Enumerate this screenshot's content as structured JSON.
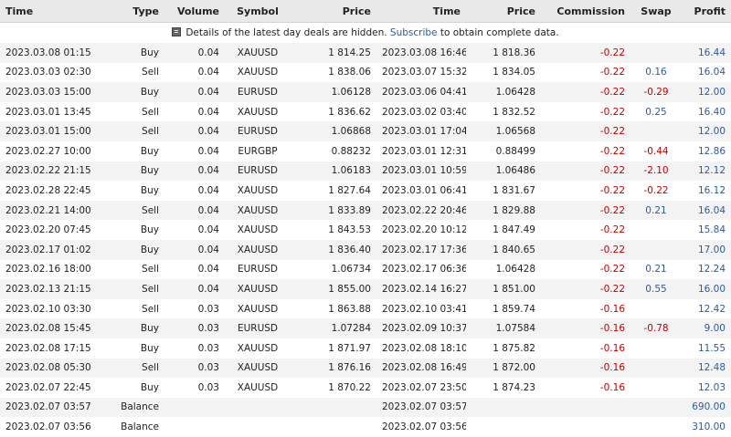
{
  "headers": [
    "Time",
    "Type",
    "Volume",
    "Symbol",
    "Price",
    "Time",
    "Price",
    "Commission",
    "Swap",
    "Profit"
  ],
  "notice": {
    "text_before": "Details of the latest day deals are hidden.",
    "link": "Subscribe",
    "text_after": "to obtain complete data."
  },
  "rows": [
    {
      "open_time": "2023.03.08 01:15",
      "type": "Buy",
      "volume": "0.04",
      "symbol": "XAUUSD",
      "open_price": "1 814.25",
      "close_time": "2023.03.08 16:46",
      "close_price": "1 818.36",
      "commission": "-0.22",
      "swap": "",
      "profit": "16.44"
    },
    {
      "open_time": "2023.03.03 02:30",
      "type": "Sell",
      "volume": "0.04",
      "symbol": "XAUUSD",
      "open_price": "1 838.06",
      "close_time": "2023.03.07 15:32",
      "close_price": "1 834.05",
      "commission": "-0.22",
      "swap": "0.16",
      "profit": "16.04"
    },
    {
      "open_time": "2023.03.03 15:00",
      "type": "Buy",
      "volume": "0.04",
      "symbol": "EURUSD",
      "open_price": "1.06128",
      "close_time": "2023.03.06 04:41",
      "close_price": "1.06428",
      "commission": "-0.22",
      "swap": "-0.29",
      "profit": "12.00"
    },
    {
      "open_time": "2023.03.01 13:45",
      "type": "Sell",
      "volume": "0.04",
      "symbol": "XAUUSD",
      "open_price": "1 836.62",
      "close_time": "2023.03.02 03:40",
      "close_price": "1 832.52",
      "commission": "-0.22",
      "swap": "0.25",
      "profit": "16.40"
    },
    {
      "open_time": "2023.03.01 15:00",
      "type": "Sell",
      "volume": "0.04",
      "symbol": "EURUSD",
      "open_price": "1.06868",
      "close_time": "2023.03.01 17:04",
      "close_price": "1.06568",
      "commission": "-0.22",
      "swap": "",
      "profit": "12.00"
    },
    {
      "open_time": "2023.02.27 10:00",
      "type": "Buy",
      "volume": "0.04",
      "symbol": "EURGBP",
      "open_price": "0.88232",
      "close_time": "2023.03.01 12:31",
      "close_price": "0.88499",
      "commission": "-0.22",
      "swap": "-0.44",
      "profit": "12.86"
    },
    {
      "open_time": "2023.02.22 21:15",
      "type": "Buy",
      "volume": "0.04",
      "symbol": "EURUSD",
      "open_price": "1.06183",
      "close_time": "2023.03.01 10:59",
      "close_price": "1.06486",
      "commission": "-0.22",
      "swap": "-2.10",
      "profit": "12.12"
    },
    {
      "open_time": "2023.02.28 22:45",
      "type": "Buy",
      "volume": "0.04",
      "symbol": "XAUUSD",
      "open_price": "1 827.64",
      "close_time": "2023.03.01 06:41",
      "close_price": "1 831.67",
      "commission": "-0.22",
      "swap": "-0.22",
      "profit": "16.12"
    },
    {
      "open_time": "2023.02.21 14:00",
      "type": "Sell",
      "volume": "0.04",
      "symbol": "XAUUSD",
      "open_price": "1 833.89",
      "close_time": "2023.02.22 20:46",
      "close_price": "1 829.88",
      "commission": "-0.22",
      "swap": "0.21",
      "profit": "16.04"
    },
    {
      "open_time": "2023.02.20 07:45",
      "type": "Buy",
      "volume": "0.04",
      "symbol": "XAUUSD",
      "open_price": "1 843.53",
      "close_time": "2023.02.20 10:12",
      "close_price": "1 847.49",
      "commission": "-0.22",
      "swap": "",
      "profit": "15.84"
    },
    {
      "open_time": "2023.02.17 01:02",
      "type": "Buy",
      "volume": "0.04",
      "symbol": "XAUUSD",
      "open_price": "1 836.40",
      "close_time": "2023.02.17 17:36",
      "close_price": "1 840.65",
      "commission": "-0.22",
      "swap": "",
      "profit": "17.00"
    },
    {
      "open_time": "2023.02.16 18:00",
      "type": "Sell",
      "volume": "0.04",
      "symbol": "EURUSD",
      "open_price": "1.06734",
      "close_time": "2023.02.17 06:36",
      "close_price": "1.06428",
      "commission": "-0.22",
      "swap": "0.21",
      "profit": "12.24"
    },
    {
      "open_time": "2023.02.13 21:15",
      "type": "Sell",
      "volume": "0.04",
      "symbol": "XAUUSD",
      "open_price": "1 855.00",
      "close_time": "2023.02.14 16:27",
      "close_price": "1 851.00",
      "commission": "-0.22",
      "swap": "0.55",
      "profit": "16.00"
    },
    {
      "open_time": "2023.02.10 03:30",
      "type": "Sell",
      "volume": "0.03",
      "symbol": "XAUUSD",
      "open_price": "1 863.88",
      "close_time": "2023.02.10 03:41",
      "close_price": "1 859.74",
      "commission": "-0.16",
      "swap": "",
      "profit": "12.42"
    },
    {
      "open_time": "2023.02.08 15:45",
      "type": "Buy",
      "volume": "0.03",
      "symbol": "EURUSD",
      "open_price": "1.07284",
      "close_time": "2023.02.09 10:37",
      "close_price": "1.07584",
      "commission": "-0.16",
      "swap": "-0.78",
      "profit": "9.00"
    },
    {
      "open_time": "2023.02.08 17:15",
      "type": "Buy",
      "volume": "0.03",
      "symbol": "XAUUSD",
      "open_price": "1 871.97",
      "close_time": "2023.02.08 18:10",
      "close_price": "1 875.82",
      "commission": "-0.16",
      "swap": "",
      "profit": "11.55"
    },
    {
      "open_time": "2023.02.08 05:30",
      "type": "Sell",
      "volume": "0.03",
      "symbol": "XAUUSD",
      "open_price": "1 876.16",
      "close_time": "2023.02.08 16:49",
      "close_price": "1 872.00",
      "commission": "-0.16",
      "swap": "",
      "profit": "12.48"
    },
    {
      "open_time": "2023.02.07 22:45",
      "type": "Buy",
      "volume": "0.03",
      "symbol": "XAUUSD",
      "open_price": "1 870.22",
      "close_time": "2023.02.07 23:50",
      "close_price": "1 874.23",
      "commission": "-0.16",
      "swap": "",
      "profit": "12.03"
    },
    {
      "open_time": "2023.02.07 03:57",
      "type": "Balance",
      "volume": "",
      "symbol": "",
      "open_price": "",
      "close_time": "2023.02.07 03:57",
      "close_price": "",
      "commission": "",
      "swap": "",
      "profit": "690.00"
    },
    {
      "open_time": "2023.02.07 03:56",
      "type": "Balance",
      "volume": "",
      "symbol": "",
      "open_price": "",
      "close_time": "2023.02.07 03:56",
      "close_price": "",
      "commission": "",
      "swap": "",
      "profit": "310.00"
    }
  ],
  "colors": {
    "negative": "#c00000",
    "positive": "#2f5b9a",
    "header_bg": "#e9e9e9",
    "stripe": "#f3f3f3"
  }
}
